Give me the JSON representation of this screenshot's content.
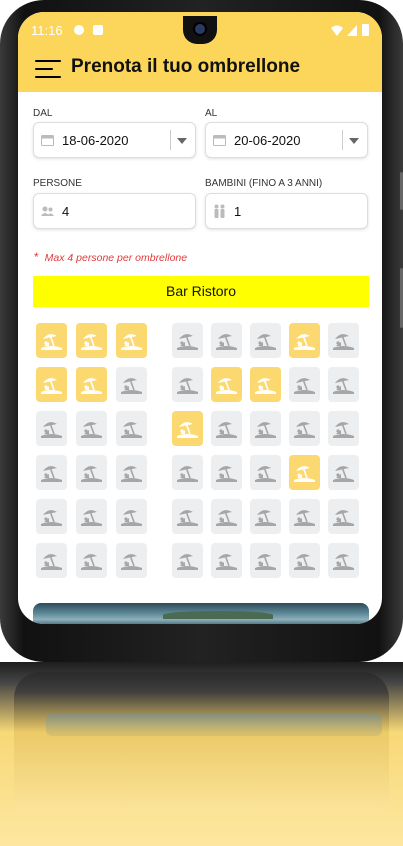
{
  "status_bar": {
    "time": "11:16"
  },
  "app_bar": {
    "title": "Prenota il tuo ombrellone"
  },
  "form": {
    "from": {
      "label": "DAL",
      "value": "18-06-2020"
    },
    "to": {
      "label": "AL",
      "value": "20-06-2020"
    },
    "persons": {
      "label": "PERSONE",
      "value": "4"
    },
    "children": {
      "label": "BAMBINI (FINO A 3 ANNI)",
      "value": "1"
    }
  },
  "note": {
    "asterisk": "*",
    "text": "Max 4 persone per ombrellone"
  },
  "section_bar": {
    "label": "Bar Ristoro"
  },
  "umbrella_grid": {
    "rows": [
      [
        true,
        true,
        true,
        false,
        false,
        false,
        true,
        false
      ],
      [
        true,
        true,
        false,
        false,
        true,
        true,
        false,
        false
      ],
      [
        false,
        false,
        false,
        true,
        false,
        false,
        false,
        false
      ],
      [
        false,
        false,
        false,
        false,
        false,
        false,
        true,
        false
      ],
      [
        false,
        false,
        false,
        false,
        false,
        false,
        false,
        false
      ],
      [
        false,
        false,
        false,
        false,
        false,
        false,
        false,
        false
      ]
    ],
    "colors": {
      "highlighted": "#fcd870",
      "available": "#eceef0",
      "icon_highlighted": "#ffffff",
      "icon_available": "#a4a6a8"
    }
  },
  "colors": {
    "accent": "#fcd65a",
    "bar": "#ffff00",
    "note": "#e03a3a"
  },
  "icons": {
    "date": "calendar-icon",
    "persons": "group-icon",
    "children": "child-icon",
    "spot": "beach-umbrella-icon",
    "menu": "menu-icon"
  }
}
